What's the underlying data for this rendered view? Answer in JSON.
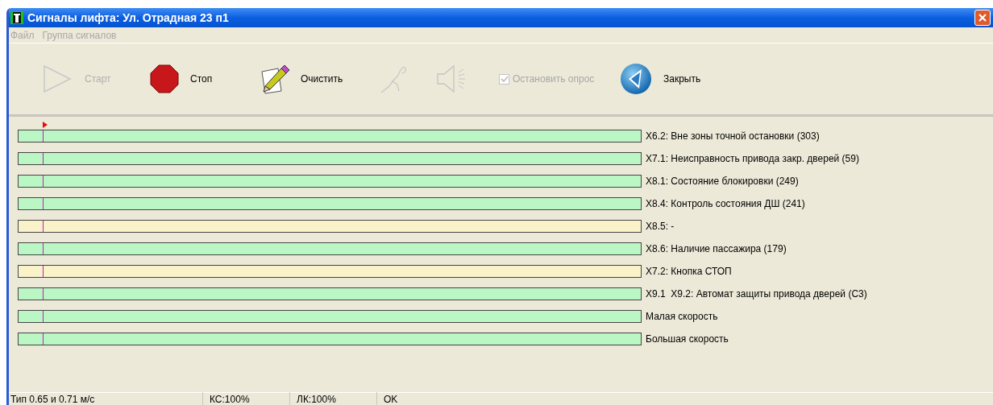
{
  "window": {
    "title": "Сигналы лифта: Ул. Отрадная 23 п1"
  },
  "menu": [
    {
      "label": "Файл",
      "disabled": true
    },
    {
      "label": "Группа сигналов",
      "disabled": true
    }
  ],
  "toolbar": [
    {
      "kind": "start",
      "label": "Старт",
      "disabled": true
    },
    {
      "kind": "stop",
      "label": "Стоп",
      "disabled": false
    },
    {
      "kind": "clear",
      "label": "Очистить",
      "disabled": false
    },
    {
      "kind": "antenna",
      "disabled": true
    },
    {
      "kind": "speaker",
      "disabled": true
    },
    {
      "kind": "checkbox",
      "label": "Остановить опрос",
      "checked": true,
      "disabled": true
    },
    {
      "kind": "close",
      "label": "Закрыть",
      "disabled": false
    }
  ],
  "signals": [
    {
      "label": "X6.2: Вне зоны точной остановки (303)",
      "color": "#bbf7c4"
    },
    {
      "label": "X7.1: Неисправность привода закр. дверей (59)",
      "color": "#bbf7c4"
    },
    {
      "label": "X8.1: Состояние блокировки (249)",
      "color": "#bbf7c4"
    },
    {
      "label": "X8.4: Контроль состояния ДШ (241)",
      "color": "#bbf7c4"
    },
    {
      "label": "X8.5: -",
      "color": "#faf3c9"
    },
    {
      "label": "X8.6: Наличие пассажира (179)",
      "color": "#bbf7c4"
    },
    {
      "label": "X7.2: Кнопка СТОП",
      "color": "#faf3c9"
    },
    {
      "label": "X9.1  X9.2: Автомат защиты привода дверей (С3)",
      "color": "#bbf7c4"
    },
    {
      "label": "Малая скорость",
      "color": "#bbf7c4"
    },
    {
      "label": "Большая скорость",
      "color": "#bbf7c4"
    }
  ],
  "status_bar": [
    "Тип 0.65 и 0.71 м/с",
    "КС:100%",
    "ЛК:100%",
    "OK"
  ]
}
